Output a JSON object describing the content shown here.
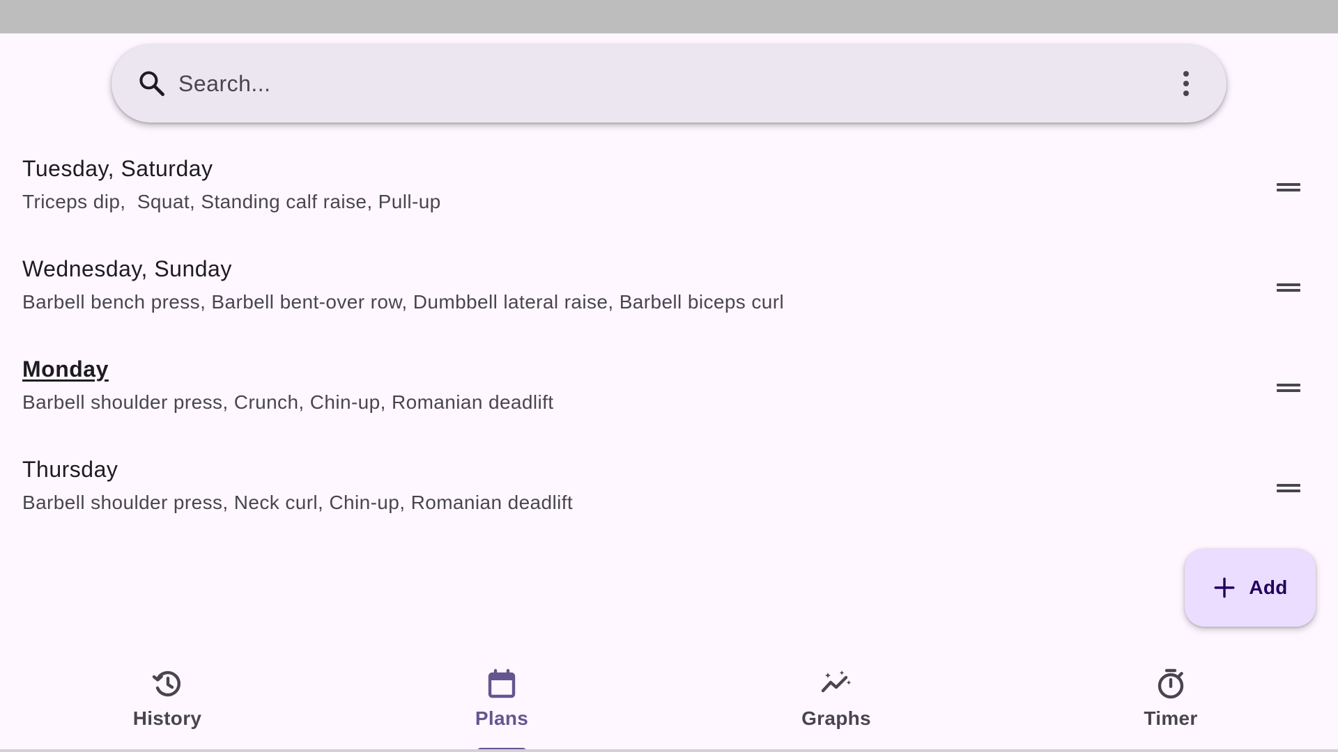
{
  "search": {
    "placeholder": "Search..."
  },
  "plans": [
    {
      "title": "Tuesday, Saturday",
      "exercises": "Triceps dip,  Squat, Standing calf raise, Pull-up",
      "current": false
    },
    {
      "title": "Wednesday, Sunday",
      "exercises": "Barbell bench press, Barbell bent-over row, Dumbbell lateral raise, Barbell biceps curl",
      "current": false
    },
    {
      "title": "Monday",
      "exercises": "Barbell shoulder press, Crunch, Chin-up, Romanian deadlift",
      "current": true
    },
    {
      "title": "Thursday",
      "exercises": "Barbell shoulder press, Neck curl, Chin-up, Romanian deadlift",
      "current": false
    }
  ],
  "fab": {
    "label": "Add",
    "icon": "plus-icon"
  },
  "nav": {
    "active": "Plans",
    "items": [
      {
        "label": "History",
        "icon": "history-icon"
      },
      {
        "label": "Plans",
        "icon": "calendar-icon"
      },
      {
        "label": "Graphs",
        "icon": "graph-icon"
      },
      {
        "label": "Timer",
        "icon": "timer-icon"
      }
    ]
  },
  "colors": {
    "accent": "#65558f",
    "fab_background": "#eaddff",
    "search_background": "#ece6f0",
    "background": "#fef7ff"
  }
}
